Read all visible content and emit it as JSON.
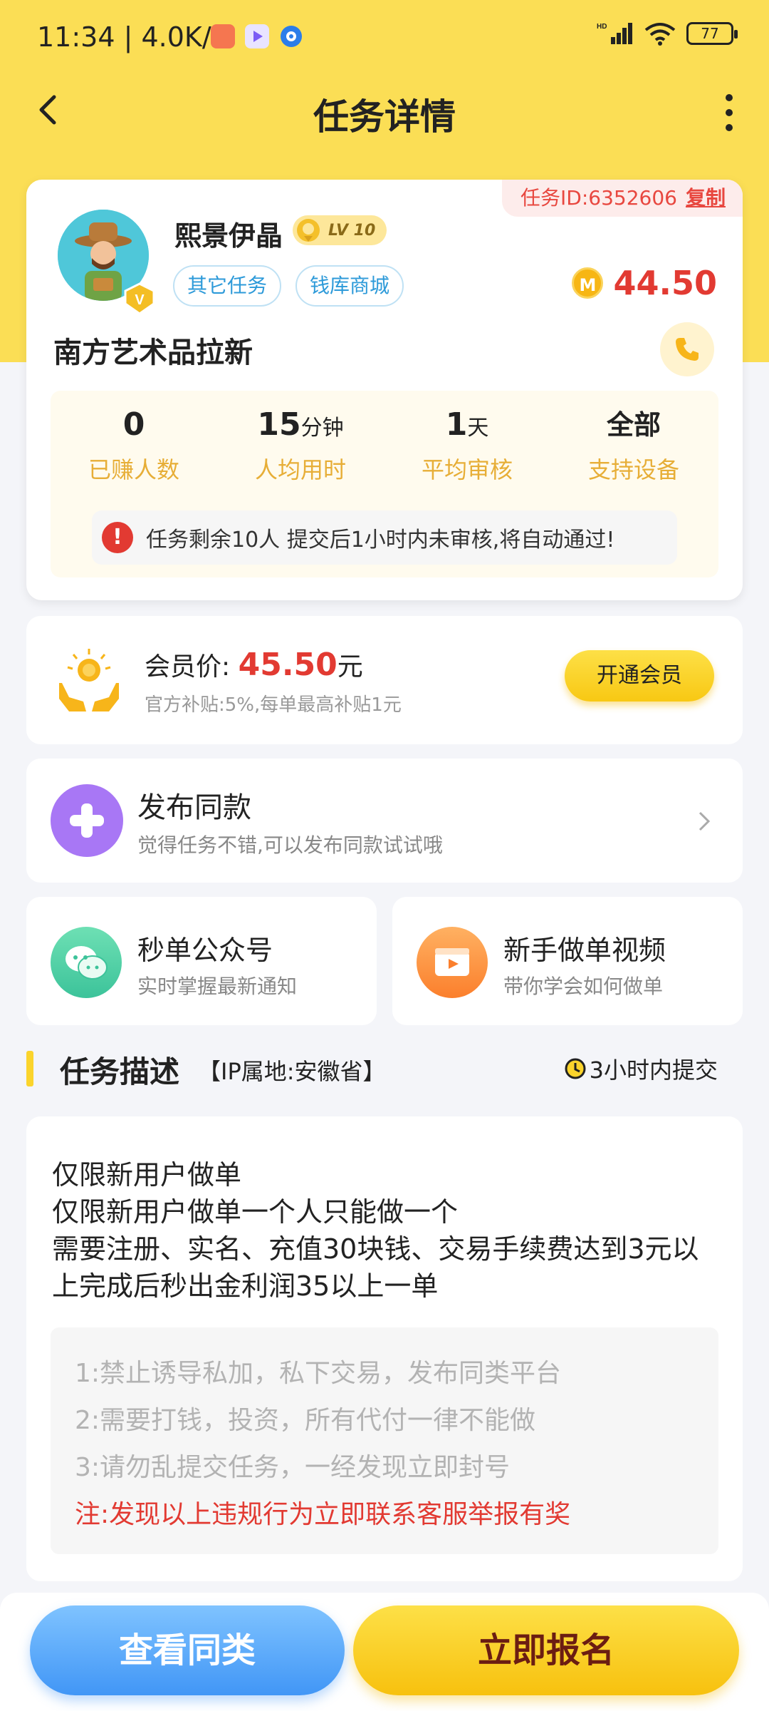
{
  "status_bar": {
    "time": "11:34 | 4.0K/s",
    "battery": "77"
  },
  "nav": {
    "title": "任务详情"
  },
  "task": {
    "id_label": "任务ID:6352606",
    "copy_label": "复制",
    "publisher": "熙景伊晶",
    "level": "LV 10",
    "tags": [
      "其它任务",
      "钱库商城"
    ],
    "reward": "44.50",
    "name": "南方艺术品拉新",
    "stats": [
      {
        "value": "0",
        "unit": "",
        "label": "已赚人数"
      },
      {
        "value": "15",
        "unit": "分钟",
        "label": "人均用时"
      },
      {
        "value": "1",
        "unit": "天",
        "label": "平均审核"
      },
      {
        "value": "全部",
        "unit": "",
        "label": "支持设备"
      }
    ],
    "notice": "任务剩余10人  提交后1小时内未审核,将自动通过!"
  },
  "member": {
    "label": "会员价:",
    "price": "45.50",
    "unit": "元",
    "sub": "官方补贴:5%,每单最高补贴1元",
    "button": "开通会员"
  },
  "publish": {
    "title": "发布同款",
    "sub": "觉得任务不错,可以发布同款试试哦"
  },
  "wechat": {
    "title": "秒单公众号",
    "sub": "实时掌握最新通知"
  },
  "video": {
    "title": "新手做单视频",
    "sub": "带你学会如何做单"
  },
  "description": {
    "title": "任务描述",
    "ip": "【IP属地:安徽省】",
    "deadline": "3小时内提交",
    "lines": [
      "仅限新用户做单",
      "仅限新用户做单一个人只能做一个",
      "需要注册、实名、充值30块钱、交易手续费达到3元以上完成后秒出金利润35以上一单"
    ],
    "rules": [
      "1:禁止诱导私加，私下交易，发布同类平台",
      "2:需要打钱，投资，所有代付一律不能做",
      "3:请勿乱提交任务，一经发现立即封号"
    ],
    "warning": "注:发现以上违规行为立即联系客服举报有奖"
  },
  "bottom": {
    "similar": "查看同类",
    "signup": "立即报名"
  },
  "colors": {
    "header_yellow": "#fbde55",
    "price_red": "#e23a32",
    "stat_label_gold": "#e7ae37",
    "tag_blue": "#2d9ad9"
  }
}
